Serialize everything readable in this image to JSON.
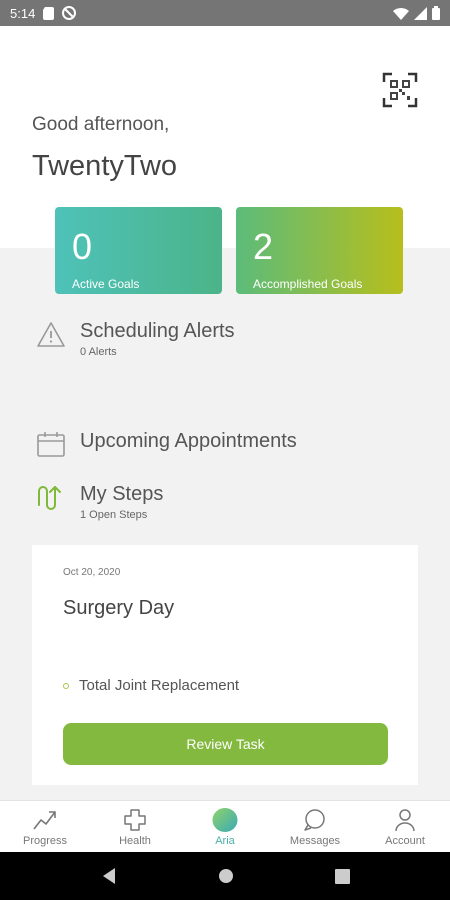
{
  "status_bar": {
    "time": "5:14"
  },
  "header": {
    "greeting": "Good afternoon,",
    "username": "TwentyTwo"
  },
  "goals": [
    {
      "count": "0",
      "label": "Active Goals"
    },
    {
      "count": "2",
      "label": "Accomplished Goals"
    }
  ],
  "sections": {
    "alerts": {
      "title": "Scheduling Alerts",
      "subtitle": "0 Alerts"
    },
    "appointments": {
      "title": "Upcoming Appointments"
    },
    "steps": {
      "title": "My Steps",
      "subtitle": "1 Open Steps"
    }
  },
  "task_card": {
    "date": "Oct 20, 2020",
    "title": "Surgery Day",
    "tag": "Total Joint Replacement",
    "button_label": "Review Task"
  },
  "bottom_nav": {
    "items": [
      {
        "label": "Progress",
        "icon": "progress-trend-icon"
      },
      {
        "label": "Health",
        "icon": "health-cross-icon"
      },
      {
        "label": "Aria",
        "icon": "aria-orb-icon"
      },
      {
        "label": "Messages",
        "icon": "message-bubble-icon"
      },
      {
        "label": "Account",
        "icon": "account-person-icon"
      }
    ],
    "active": "Aria"
  },
  "colors": {
    "accent_green": "#84b93f",
    "teal": "#4ec2b9",
    "lime": "#b7be1c"
  }
}
